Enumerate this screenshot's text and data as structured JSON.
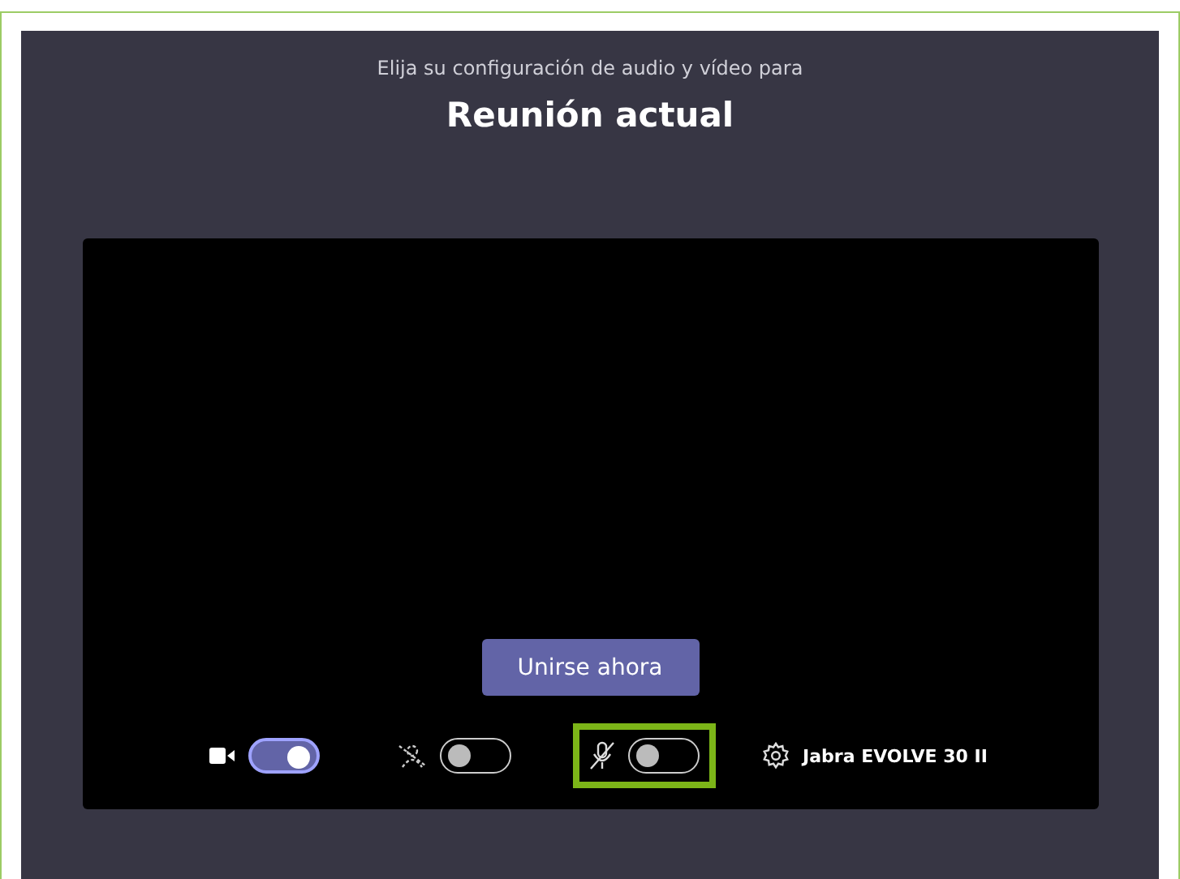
{
  "subtitle": "Elija su configuración de audio y vídeo para",
  "title": "Reunión actual",
  "join_button": "Unirse ahora",
  "controls": [
    {
      "kind": "camera",
      "on": true,
      "highlighted": false
    },
    {
      "kind": "blur",
      "on": false,
      "highlighted": false
    },
    {
      "kind": "microphone",
      "on": false,
      "highlighted": true
    }
  ],
  "device": "Jabra EVOLVE 30 II"
}
